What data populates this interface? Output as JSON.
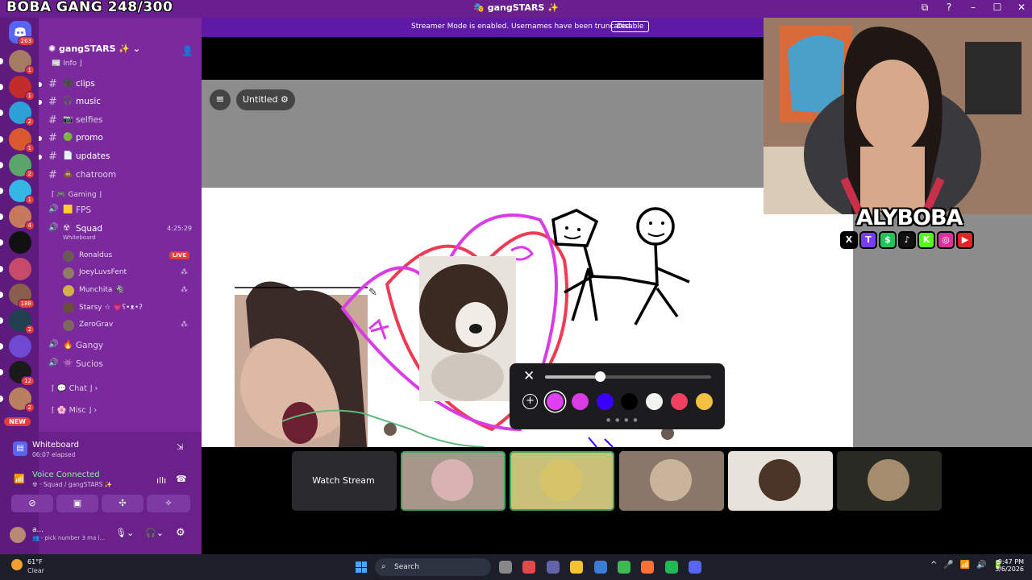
{
  "overlay_title": "BOBA GANG 248/300",
  "window": {
    "title": "🎭 gangSTARS ✨",
    "controls": [
      "⧉",
      "?",
      "–",
      "☐",
      "✕"
    ]
  },
  "streamer_banner": {
    "text": "Streamer Mode is enabled. Usernames have been truncated.",
    "button": "Disable"
  },
  "rail": {
    "home_badge": "263",
    "servers": [
      {
        "badge": "1",
        "color": "#a57b63"
      },
      {
        "badge": "1",
        "color": "#c22b2b"
      },
      {
        "badge": "2",
        "color": "#2ba1d6"
      },
      {
        "badge": "1",
        "color": "#d9582e"
      },
      {
        "badge": "2",
        "color": "#5aa66a"
      },
      {
        "badge": "1",
        "color": "#35b7e6"
      },
      {
        "badge": "4",
        "color": "#c7795e"
      },
      {
        "badge": "",
        "color": "#111111"
      },
      {
        "badge": "",
        "color": "#c74a6b"
      },
      {
        "badge": "188",
        "color": "#8a5e4d"
      },
      {
        "badge": "2",
        "color": "#204050"
      },
      {
        "badge": "",
        "color": "#6d4ad1"
      },
      {
        "badge": "12",
        "color": "#1a1a1a"
      },
      {
        "badge": "2",
        "color": "#b98060"
      }
    ],
    "new_label": "NEW"
  },
  "server": {
    "name": "gangSTARS ✨",
    "chevron": "⌄"
  },
  "channels": [
    {
      "label": "Info ⌋",
      "icon": "📰",
      "kind": "cat-partial"
    },
    {
      "label": "clips",
      "icon": "🎥",
      "unread": true
    },
    {
      "label": "music",
      "icon": "🎧",
      "unread": true
    },
    {
      "label": "selfies",
      "icon": "📷",
      "unread": false
    },
    {
      "label": "promo",
      "icon": "🟢",
      "unread": true
    },
    {
      "label": "updates",
      "icon": "📄",
      "unread": true
    },
    {
      "label": "chatroom",
      "icon": "💩",
      "unread": false
    }
  ],
  "category_gaming": "⌈ 🎮 Gaming ⌋",
  "voice_channels": [
    {
      "label": "FPS",
      "icon": "🟨"
    },
    {
      "label": "Squad",
      "icon": "☢",
      "timer": "4:25:29",
      "activity": "Whiteboard"
    }
  ],
  "squad_members": [
    {
      "name": "Ronaldus",
      "live": "LIVE",
      "color": "#6b5a52"
    },
    {
      "name": "JoeyLuvsFent",
      "color": "#8f7b66"
    },
    {
      "name": "Munchita 🦓",
      "color": "#d2b04e"
    },
    {
      "name": "Starsy ☆ 💗ʕ•ᴥ•ʔ",
      "color": "#6a4e3c"
    },
    {
      "name": "ZeroGrav",
      "color": "#7c6860"
    }
  ],
  "voice_channels_2": [
    {
      "label": "Gangy",
      "icon": "🔥"
    },
    {
      "label": "Sucios",
      "icon": "👾"
    }
  ],
  "collapsed_categories": [
    {
      "label": "⌈ 💬 Chat ⌋",
      "chev": "›"
    },
    {
      "label": "⌈ 🌸 Misc ⌋",
      "chev": "›"
    }
  ],
  "activity": {
    "title": "Whiteboard",
    "elapsed": "06:07 elapsed"
  },
  "voice": {
    "status": "Voice Connected",
    "location": "☢ · Squad / gangSTARS ✨"
  },
  "me": {
    "name": "a...",
    "status": "👥 · pick number 3 ma l..."
  },
  "board": {
    "title": "Untitled",
    "gear": "⚙"
  },
  "drawing_toolbar": {
    "close": "✕",
    "add": "+",
    "brush_size": 0.33,
    "colors": [
      "#e040ef",
      "#d93be6",
      "#3a00ff",
      "#000000",
      "#f2f2ee",
      "#f04060",
      "#f4c040"
    ],
    "selected": 0
  },
  "brand": {
    "name": "ALYBOBA",
    "socials": [
      "X",
      "T",
      "$",
      "♪",
      "K",
      "◎",
      "▶"
    ],
    "social_colors": [
      "#000000",
      "#7a3cf0",
      "#25c25a",
      "#111111",
      "#53fc18",
      "#d9339b",
      "#e22424"
    ]
  },
  "watch_stream": "Watch Stream",
  "tiles": [
    {
      "bg": "#a6978a",
      "face": "#d9b3b3",
      "speaking": true
    },
    {
      "bg": "#c9c07a",
      "face": "#d6c46a",
      "speaking": true
    },
    {
      "bg": "#8b776a",
      "face": "#c9b49b",
      "speaking": false
    },
    {
      "bg": "#e8e2dc",
      "face": "#4a3526",
      "speaking": false
    },
    {
      "bg": "#2a2a24",
      "face": "#a58c6c",
      "speaking": false
    }
  ],
  "taskbar": {
    "temp": "61°F",
    "condition": "Clear",
    "search": "Search",
    "apps": [
      "#888888",
      "#e24a4a",
      "#6264a7",
      "#f4c430",
      "#3a7bd5",
      "#3cba54",
      "#ff7139",
      "#1db954",
      "#5865f2"
    ],
    "tray": [
      "^",
      "🎤",
      "📶",
      "🔊",
      "🔋"
    ],
    "time": "9:47 PM",
    "date": "3/6/2026"
  }
}
